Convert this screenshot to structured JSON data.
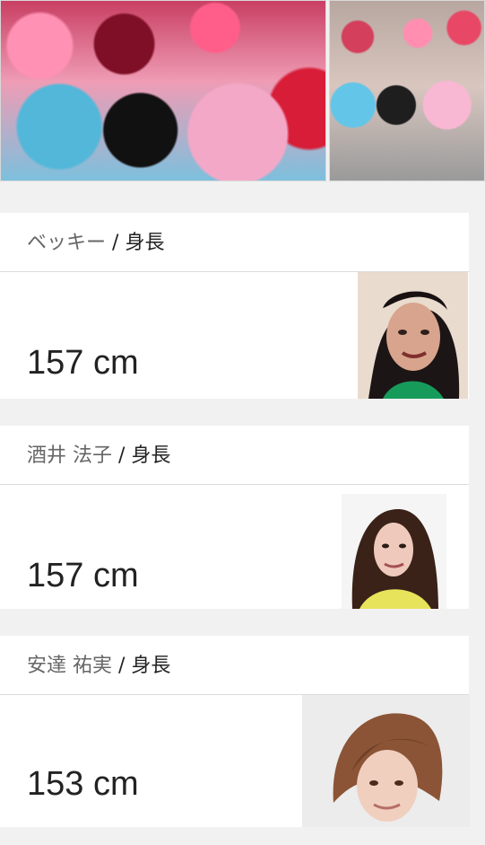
{
  "people": [
    {
      "name": "ベッキー",
      "separator": "/",
      "height_label": "身長",
      "height_value": "157 cm"
    },
    {
      "name": "酒井 法子",
      "separator": "/",
      "height_label": "身長",
      "height_value": "157 cm"
    },
    {
      "name": "安達 祐実",
      "separator": "/",
      "height_label": "身長",
      "height_value": "153 cm"
    }
  ],
  "images": [
    {
      "name": "left-photo",
      "type": "photo"
    },
    {
      "name": "right-photo",
      "type": "photo"
    },
    {
      "name": "avatar-becky",
      "type": "portrait"
    },
    {
      "name": "avatar-sakai",
      "type": "portrait"
    },
    {
      "name": "avatar-adachi",
      "type": "portrait"
    }
  ],
  "colors": {
    "background": "#f1f1f1",
    "card": "#ffffff",
    "text_primary": "#222222",
    "text_secondary": "#666666",
    "border": "#dcdcdc"
  }
}
